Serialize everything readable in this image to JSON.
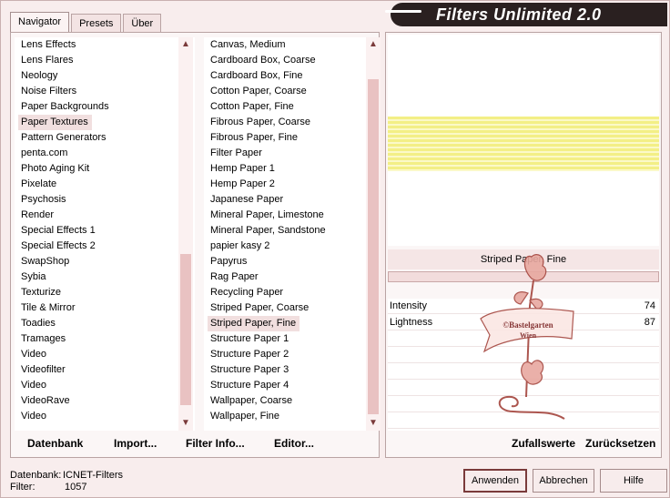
{
  "window": {
    "title": "Filters Unlimited 2.0"
  },
  "tabs": [
    {
      "label": "Navigator",
      "active": true
    },
    {
      "label": "Presets",
      "active": false
    },
    {
      "label": "Über",
      "active": false
    }
  ],
  "categories": {
    "items": [
      "Lens Effects",
      "Lens Flares",
      "Neology",
      "Noise Filters",
      "Paper Backgrounds",
      "Paper Textures",
      "Pattern Generators",
      "penta.com",
      "Photo Aging Kit",
      "Pixelate",
      "Psychosis",
      "Render",
      "Special Effects 1",
      "Special Effects 2",
      "SwapShop",
      "Sybia",
      "Texturize",
      "Tile & Mirror",
      "Toadies",
      "Tramages",
      "Video",
      "Videofilter",
      "Video",
      "VideoRave",
      "Video"
    ],
    "selected": "Paper Textures"
  },
  "filters": {
    "items": [
      "Canvas, Medium",
      "Cardboard Box, Coarse",
      "Cardboard Box, Fine",
      "Cotton Paper, Coarse",
      "Cotton Paper, Fine",
      "Fibrous Paper, Coarse",
      "Fibrous Paper, Fine",
      "Filter Paper",
      "Hemp Paper 1",
      "Hemp Paper 2",
      "Japanese Paper",
      "Mineral Paper, Limestone",
      "Mineral Paper, Sandstone",
      "papier kasy 2",
      "Papyrus",
      "Rag Paper",
      "Recycling Paper",
      "Striped Paper, Coarse",
      "Striped Paper, Fine",
      "Structure Paper 1",
      "Structure Paper 2",
      "Structure Paper 3",
      "Structure Paper 4",
      "Wallpaper, Coarse",
      "Wallpaper, Fine"
    ],
    "selected": "Striped Paper, Fine"
  },
  "panel_buttons": {
    "datenbank": "Datenbank",
    "import": "Import...",
    "filter_info": "Filter Info...",
    "editor": "Editor..."
  },
  "preview": {
    "filter_name": "Striped Paper, Fine",
    "watermark_text": [
      "©Bastelgarten",
      "Wien"
    ]
  },
  "params": [
    {
      "name": "Intensity",
      "value": "74"
    },
    {
      "name": "Lightness",
      "value": "87"
    }
  ],
  "right_buttons": {
    "zufallswerte": "Zufallswerte",
    "zuruecksetzen": "Zurücksetzen"
  },
  "status": {
    "datenbank_label": "Datenbank:",
    "datenbank_value": "ICNET-Filters",
    "filter_label": "Filter:",
    "filter_value": "1057"
  },
  "dialog_buttons": {
    "apply": "Anwenden",
    "cancel": "Abbrechen",
    "help": "Hilfe"
  }
}
